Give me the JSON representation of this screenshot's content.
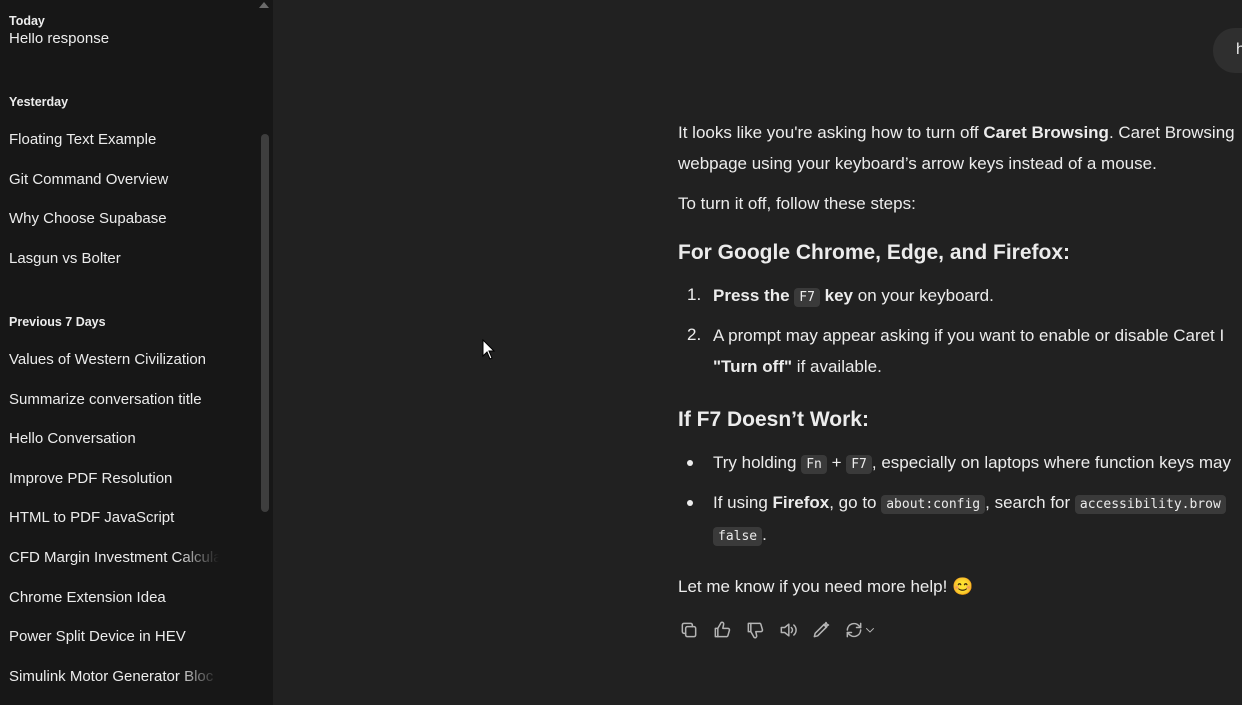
{
  "sidebar": {
    "today": {
      "heading": "Today",
      "items": [
        "Hello response"
      ]
    },
    "yesterday": {
      "heading": "Yesterday",
      "items": [
        "Floating Text Example",
        "Git Command Overview",
        "Why Choose Supabase",
        "Lasgun vs Bolter"
      ]
    },
    "previous7": {
      "heading": "Previous 7 Days",
      "items": [
        "Values of Western Civilization",
        "Summarize conversation title",
        "Hello Conversation",
        "Improve PDF Resolution",
        "HTML to PDF JavaScript",
        "CFD Margin Investment Calcula",
        "Chrome Extension Idea",
        "Power Split Device in HEV",
        "Simulink Motor Generator Bloc"
      ]
    }
  },
  "chat": {
    "user_message": "h",
    "intro_p1_before": "It looks like you're asking how to turn off ",
    "intro_p1_bold": "Caret Browsing",
    "intro_p1_after": ". Caret Browsing",
    "intro_p1_line2": "webpage using your keyboard’s arrow keys instead of a mouse.",
    "intro_p2": "To turn it off, follow these steps:",
    "heading1": "For Google Chrome, Edge, and Firefox:",
    "step1_num": "1.",
    "step1_bold_a": "Press the ",
    "step1_code": "F7",
    "step1_bold_b": " key",
    "step1_rest": " on your keyboard.",
    "step2_num": "2.",
    "step2_line1": "A prompt may appear asking if you want to enable or disable Caret I",
    "step2_bold": "\"Turn off\"",
    "step2_rest": " if available.",
    "heading2": "If F7 Doesn’t Work:",
    "bullet1_a": "Try holding ",
    "bullet1_code1": "Fn",
    "bullet1_plus": " + ",
    "bullet1_code2": "F7",
    "bullet1_rest": ", especially on laptops where function keys may",
    "bullet2_a": "If using ",
    "bullet2_bold": "Firefox",
    "bullet2_b": ", go to ",
    "bullet2_code1": "about:config",
    "bullet2_c": ", search for ",
    "bullet2_code2": "accessibility.brow",
    "bullet2_code3": "false",
    "bullet2_end": ".",
    "closing": "Let me know if you need more help! 😊"
  },
  "actions": [
    "copy-icon",
    "thumbs-up-icon",
    "thumbs-down-icon",
    "read-aloud-icon",
    "edit-icon",
    "regenerate-icon"
  ]
}
